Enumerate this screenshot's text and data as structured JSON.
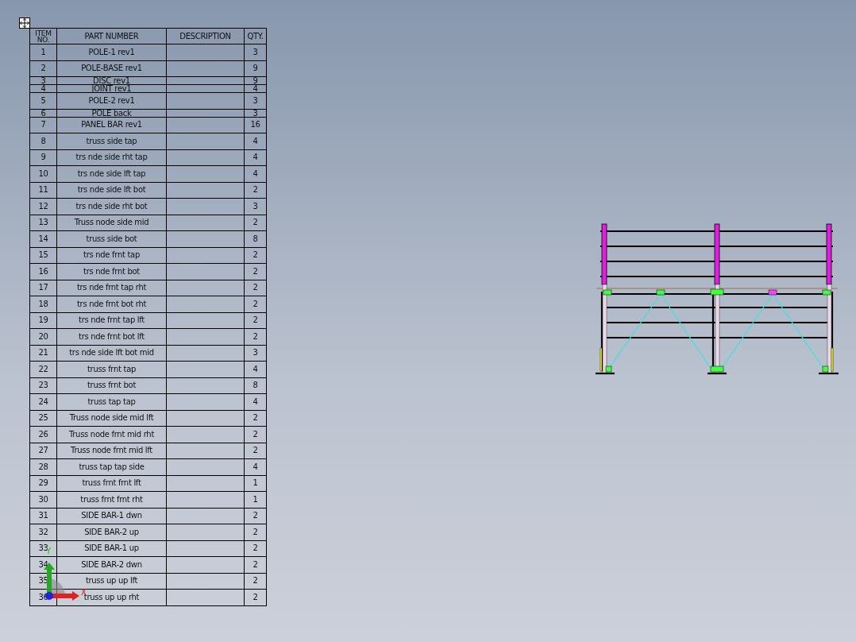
{
  "bom_table": {
    "columns": [
      "ITEM NO.",
      "PART NUMBER",
      "DESCRIPTION",
      "QTY."
    ],
    "rows": [
      {
        "item": "1",
        "part_number": "POLE-1 rev1",
        "qty": "3",
        "kind": "normal"
      },
      {
        "item": "2",
        "part_number": "POLE-BASE rev1",
        "qty": "9",
        "kind": "normal"
      },
      {
        "item": "3",
        "part_number": "DISC rev1",
        "qty": "9",
        "kind": "squeezed"
      },
      {
        "item": "4",
        "part_number": "JOINT rev1",
        "qty": "4",
        "kind": "squeezed"
      },
      {
        "item": "5",
        "part_number": "POLE-2 rev1",
        "qty": "3",
        "kind": "normal"
      },
      {
        "item": "6",
        "part_number": "POLE back",
        "qty": "3",
        "kind": "squeezed"
      },
      {
        "item": "7",
        "part_number": "PANEL BAR rev1",
        "qty": "16",
        "kind": "normal"
      },
      {
        "item": "8",
        "part_number": "truss side tap",
        "qty": "4",
        "kind": "normal"
      },
      {
        "item": "9",
        "part_number": "trs nde side rht tap",
        "qty": "4",
        "kind": "normal"
      },
      {
        "item": "10",
        "part_number": "trs nde side lft tap",
        "qty": "4",
        "kind": "normal"
      },
      {
        "item": "11",
        "part_number": "trs nde side lft bot",
        "qty": "2",
        "kind": "normal"
      },
      {
        "item": "12",
        "part_number": "trs nde side rht bot",
        "qty": "3",
        "kind": "normal"
      },
      {
        "item": "13",
        "part_number": "Truss node side mid",
        "qty": "2",
        "kind": "normal"
      },
      {
        "item": "14",
        "part_number": "truss side bot",
        "qty": "8",
        "kind": "normal"
      },
      {
        "item": "15",
        "part_number": "trs nde frnt tap",
        "qty": "2",
        "kind": "normal"
      },
      {
        "item": "16",
        "part_number": "trs nde frnt bot",
        "qty": "2",
        "kind": "normal"
      },
      {
        "item": "17",
        "part_number": "trs nde frnt tap rht",
        "qty": "2",
        "kind": "normal"
      },
      {
        "item": "18",
        "part_number": "trs nde frnt bot rht",
        "qty": "2",
        "kind": "normal"
      },
      {
        "item": "19",
        "part_number": "trs nde frnt tap lft",
        "qty": "2",
        "kind": "normal"
      },
      {
        "item": "20",
        "part_number": "trs nde frnt bot lft",
        "qty": "2",
        "kind": "normal"
      },
      {
        "item": "21",
        "part_number": "trs nde side lft bot mid",
        "qty": "3",
        "kind": "normal"
      },
      {
        "item": "22",
        "part_number": "truss frnt tap",
        "qty": "4",
        "kind": "normal"
      },
      {
        "item": "23",
        "part_number": "truss frnt bot",
        "qty": "8",
        "kind": "normal"
      },
      {
        "item": "24",
        "part_number": "truss tap tap",
        "qty": "4",
        "kind": "normal"
      },
      {
        "item": "25",
        "part_number": "Truss node side mid lft",
        "qty": "2",
        "kind": "normal"
      },
      {
        "item": "26",
        "part_number": "Truss node frnt mid rht",
        "qty": "2",
        "kind": "normal"
      },
      {
        "item": "27",
        "part_number": "Truss node frnt mid lft",
        "qty": "2",
        "kind": "normal"
      },
      {
        "item": "28",
        "part_number": "truss tap tap side",
        "qty": "4",
        "kind": "normal"
      },
      {
        "item": "29",
        "part_number": "truss frnt frnt lft",
        "qty": "1",
        "kind": "normal"
      },
      {
        "item": "30",
        "part_number": "truss frnt frnt rht",
        "qty": "1",
        "kind": "normal"
      },
      {
        "item": "31",
        "part_number": "SIDE BAR-1 dwn",
        "qty": "2",
        "kind": "normal"
      },
      {
        "item": "32",
        "part_number": "SIDE BAR-2 up",
        "qty": "2",
        "kind": "normal"
      },
      {
        "item": "33",
        "part_number": "SIDE BAR-1 up",
        "qty": "2",
        "kind": "normal"
      },
      {
        "item": "34",
        "part_number": "SIDE BAR-2 dwn",
        "qty": "2",
        "kind": "normal"
      },
      {
        "item": "35",
        "part_number": "truss up up lft",
        "qty": "2",
        "kind": "normal"
      },
      {
        "item": "36",
        "part_number": "truss up up rht",
        "qty": "2",
        "kind": "normal"
      }
    ]
  },
  "triad": {
    "x_label": "X",
    "y_label": "Y"
  }
}
